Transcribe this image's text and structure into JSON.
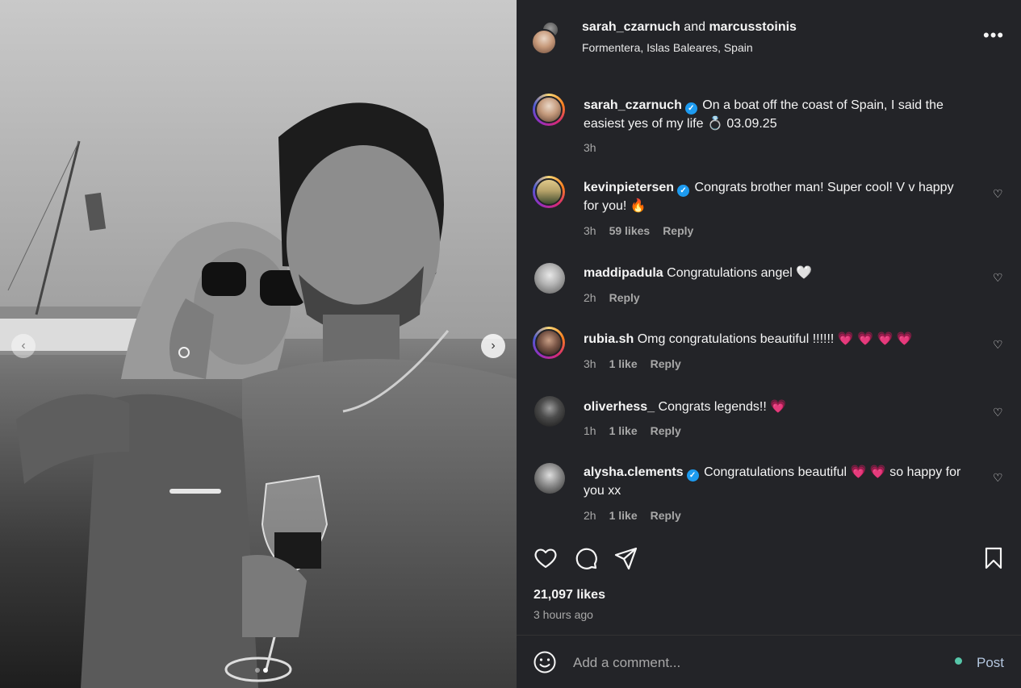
{
  "header": {
    "user1": "sarah_czarnuch",
    "and_text": "and",
    "user2": "marcusstoinis",
    "location": "Formentera, Islas Baleares, Spain",
    "more": "•••"
  },
  "comments": [
    {
      "user": "sarah_czarnuch",
      "verified": true,
      "text": "On a boat off the coast of Spain, I said the easiest yes of my life 💍 03.09.25",
      "time": "3h",
      "likes": "",
      "reply": ""
    },
    {
      "user": "kevinpietersen",
      "verified": true,
      "text": "Congrats brother man! Super cool! V v happy for you! 🔥",
      "time": "3h",
      "likes": "59 likes",
      "reply": "Reply"
    },
    {
      "user": "maddipadula",
      "verified": false,
      "text": "Congratulations angel 🤍",
      "time": "2h",
      "likes": "",
      "reply": "Reply"
    },
    {
      "user": "rubia.sh",
      "verified": false,
      "text": "Omg congratulations beautiful !!!!!! 💗 💗 💗 💗",
      "time": "3h",
      "likes": "1 like",
      "reply": "Reply"
    },
    {
      "user": "oliverhess_",
      "verified": false,
      "text": "Congrats legends!! 💗",
      "time": "1h",
      "likes": "1 like",
      "reply": "Reply"
    },
    {
      "user": "alysha.clements",
      "verified": true,
      "text": "Congratulations beautiful 💗 💗 so happy for you xx",
      "time": "2h",
      "likes": "1 like",
      "reply": "Reply"
    }
  ],
  "stats": {
    "likes": "21,097 likes",
    "time_ago": "3 hours ago"
  },
  "comment_box": {
    "placeholder": "Add a comment...",
    "post_label": "Post"
  },
  "icons": {
    "like": "heart-icon",
    "comment": "comment-icon",
    "share": "share-icon",
    "save": "bookmark-icon",
    "emoji": "emoji-icon",
    "prev": "chevron-left-icon",
    "next": "chevron-right-icon",
    "verified": "verified-badge-icon"
  },
  "colors": {
    "panel_bg": "#232428",
    "verified": "#1d9bf0",
    "heart": "#ff3b6b",
    "status_dot": "#56c6a9"
  },
  "carousel": {
    "slides": 2,
    "active_slide": 2
  }
}
